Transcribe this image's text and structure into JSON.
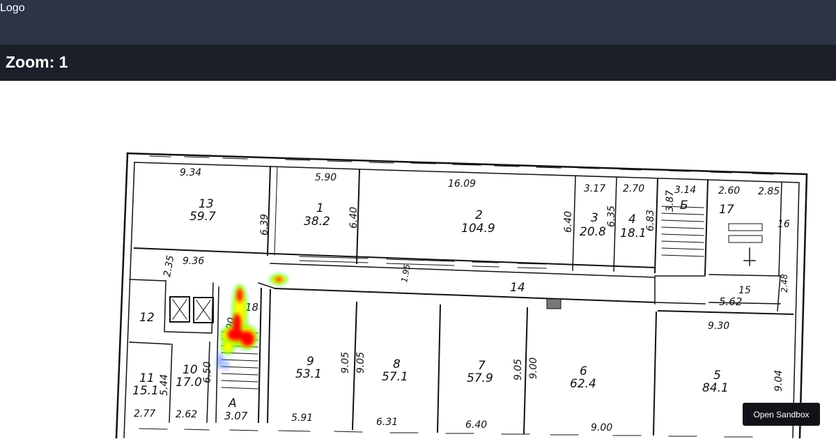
{
  "header": {
    "logo": "Logo"
  },
  "zoom": {
    "label": "Zoom: 1"
  },
  "floorplan": {
    "rooms": [
      {
        "id": "13",
        "area": "59.7"
      },
      {
        "id": "1",
        "area": "38.2"
      },
      {
        "id": "2",
        "area": "104.9"
      },
      {
        "id": "3",
        "area": "20.8"
      },
      {
        "id": "4",
        "area": "18.1"
      },
      {
        "id": "Б",
        "area": ""
      },
      {
        "id": "17",
        "area": ""
      },
      {
        "id": "16",
        "area": ""
      },
      {
        "id": "14",
        "area": ""
      },
      {
        "id": "15",
        "area": "5.62"
      },
      {
        "id": "12",
        "area": ""
      },
      {
        "id": "18",
        "area": ""
      },
      {
        "id": "11",
        "area": "15.1"
      },
      {
        "id": "10",
        "area": "17.0"
      },
      {
        "id": "A",
        "area": "3.07"
      },
      {
        "id": "9",
        "area": "53.1"
      },
      {
        "id": "8",
        "area": "57.1"
      },
      {
        "id": "7",
        "area": "57.9"
      },
      {
        "id": "6",
        "area": "62.4"
      },
      {
        "id": "5",
        "area": "84.1"
      }
    ],
    "dimensions": [
      "9.34",
      "5.90",
      "16.09",
      "3.17",
      "2.70",
      "3.14",
      "2.60",
      "2.85",
      "6.39",
      "6.40",
      "6.40",
      "6.35",
      "6.83",
      "3.87",
      "9.36",
      "2.35",
      "1.95",
      "5.44",
      "6.50",
      "9.05",
      "9.05",
      "9.05",
      "9.00",
      "9.04",
      "2.48",
      "2.77",
      "2.62",
      "5.91",
      "6.31",
      "6.40",
      "9.00",
      "9.30",
      "90."
    ]
  },
  "heatmap": {
    "colors": [
      "#ff0000",
      "#ffff00",
      "#00ff00",
      "#4a7dff"
    ]
  },
  "sandbox": {
    "label": "Open Sandbox"
  }
}
